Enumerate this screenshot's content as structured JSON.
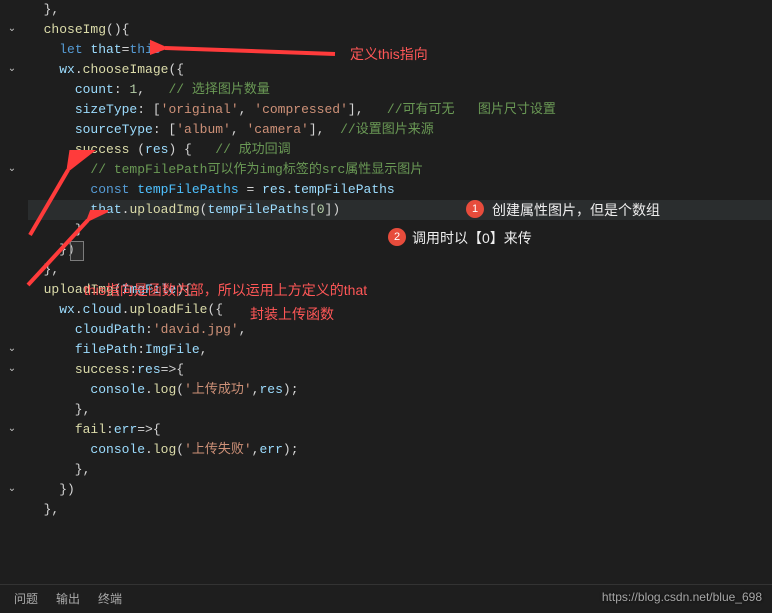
{
  "code": {
    "l1": "  },",
    "l2_fn": "choseImg",
    "l3_let": "let",
    "l3_that": "that",
    "l3_this": "this",
    "l4_wx": "wx",
    "l4_choose": "chooseImage",
    "l5_count": "count",
    "l5_num": "1",
    "l5_cmt": "// 选择图片数量",
    "l6_size": "sizeType",
    "l6_o": "'original'",
    "l6_c": "'compressed'",
    "l6_cmt": "//可有可无   图片尺寸设置",
    "l7_src": "sourceType",
    "l7_a": "'album'",
    "l7_cam": "'camera'",
    "l7_cmt": "//设置图片来源",
    "l8_suc": "success",
    "l8_res": "res",
    "l8_cmt": "// 成功回调",
    "l9_cmt": "// tempFilePath可以作为img标签的src属性显示图片",
    "l10_const": "const",
    "l10_tfp": "tempFilePaths",
    "l10_res": "res",
    "l10_p": "tempFilePaths",
    "l11_that": "that",
    "l11_up": "uploadImg",
    "l11_arg": "tempFilePaths",
    "l11_idx": "0",
    "l14": "    })",
    "l15": "  },",
    "l16_fn": "uploadImg",
    "l16_arg": "ImgFile",
    "l17_wx": "wx",
    "l17_cloud": "cloud",
    "l17_up": "uploadFile",
    "l18_cp": "cloudPath",
    "l18_v": "'david.jpg'",
    "l19_fp": "filePath",
    "l19_v": "ImgFile",
    "l20_suc": "success",
    "l20_res": "res",
    "l21_con": "console",
    "l21_log": "log",
    "l21_s": "'上传成功'",
    "l21_r": "res",
    "l22": "      },",
    "l23_fail": "fail",
    "l23_err": "err",
    "l24_con": "console",
    "l24_log": "log",
    "l24_s": "'上传失败'",
    "l24_e": "err",
    "l25": "      },",
    "l26": "    })",
    "l27": "  },"
  },
  "ann": {
    "a1": "定义this指向",
    "a2": "创建属性图片，但是个数组",
    "a3": "调用时以【0】来传",
    "a4": "this指向是函数内部，所以运用上方定义的that",
    "a5": "封装上传函数"
  },
  "badges": {
    "b1": "1",
    "b2": "2"
  },
  "panel": {
    "t1": "问题",
    "t2": "输出",
    "t3": "终端"
  },
  "watermark": "https://blog.csdn.net/blue_698"
}
